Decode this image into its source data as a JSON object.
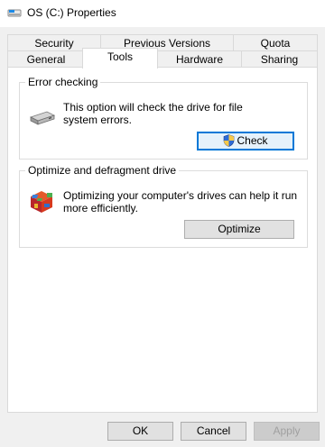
{
  "window": {
    "title": "OS (C:) Properties"
  },
  "tabs": {
    "row1": [
      "Security",
      "Previous Versions",
      "Quota"
    ],
    "row2": [
      "General",
      "Tools",
      "Hardware",
      "Sharing"
    ],
    "selected": "Tools"
  },
  "error_checking": {
    "title": "Error checking",
    "description": "This option will check the drive for file system errors.",
    "button_label": "Check"
  },
  "optimize": {
    "title": "Optimize and defragment drive",
    "description": "Optimizing your computer's drives can help it run more efficiently.",
    "button_label": "Optimize"
  },
  "footer": {
    "ok_label": "OK",
    "cancel_label": "Cancel",
    "apply_label": "Apply"
  }
}
